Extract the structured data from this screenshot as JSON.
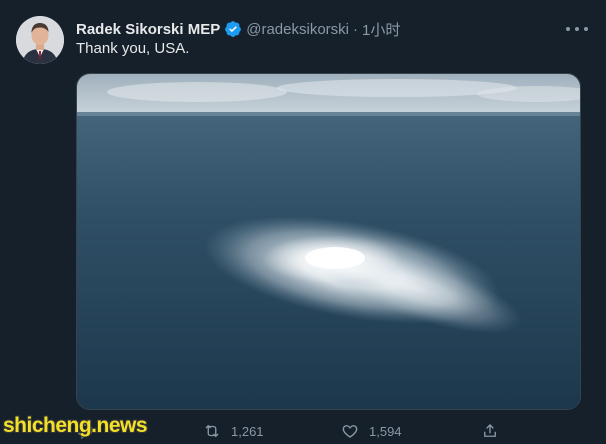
{
  "author": {
    "name": "Radek Sikorski MEP",
    "handle": "@radeksikorski",
    "separator": "·",
    "time": "1小时"
  },
  "tweet": {
    "text": "Thank you, USA."
  },
  "actions": {
    "reply_count": "",
    "retweet_count": "1,261",
    "like_count": "1,594"
  },
  "watermark": {
    "text": "shicheng.news"
  },
  "colors": {
    "background": "#15202b",
    "text": "#e7e9ea",
    "muted": "#8b98a5",
    "verified": "#1d9bf0",
    "watermark": "#f3e028"
  },
  "icons": {
    "verified": "verified-badge-icon",
    "more": "more-options-icon",
    "reply": "reply-icon",
    "retweet": "retweet-icon",
    "like": "like-icon",
    "share": "share-icon"
  }
}
